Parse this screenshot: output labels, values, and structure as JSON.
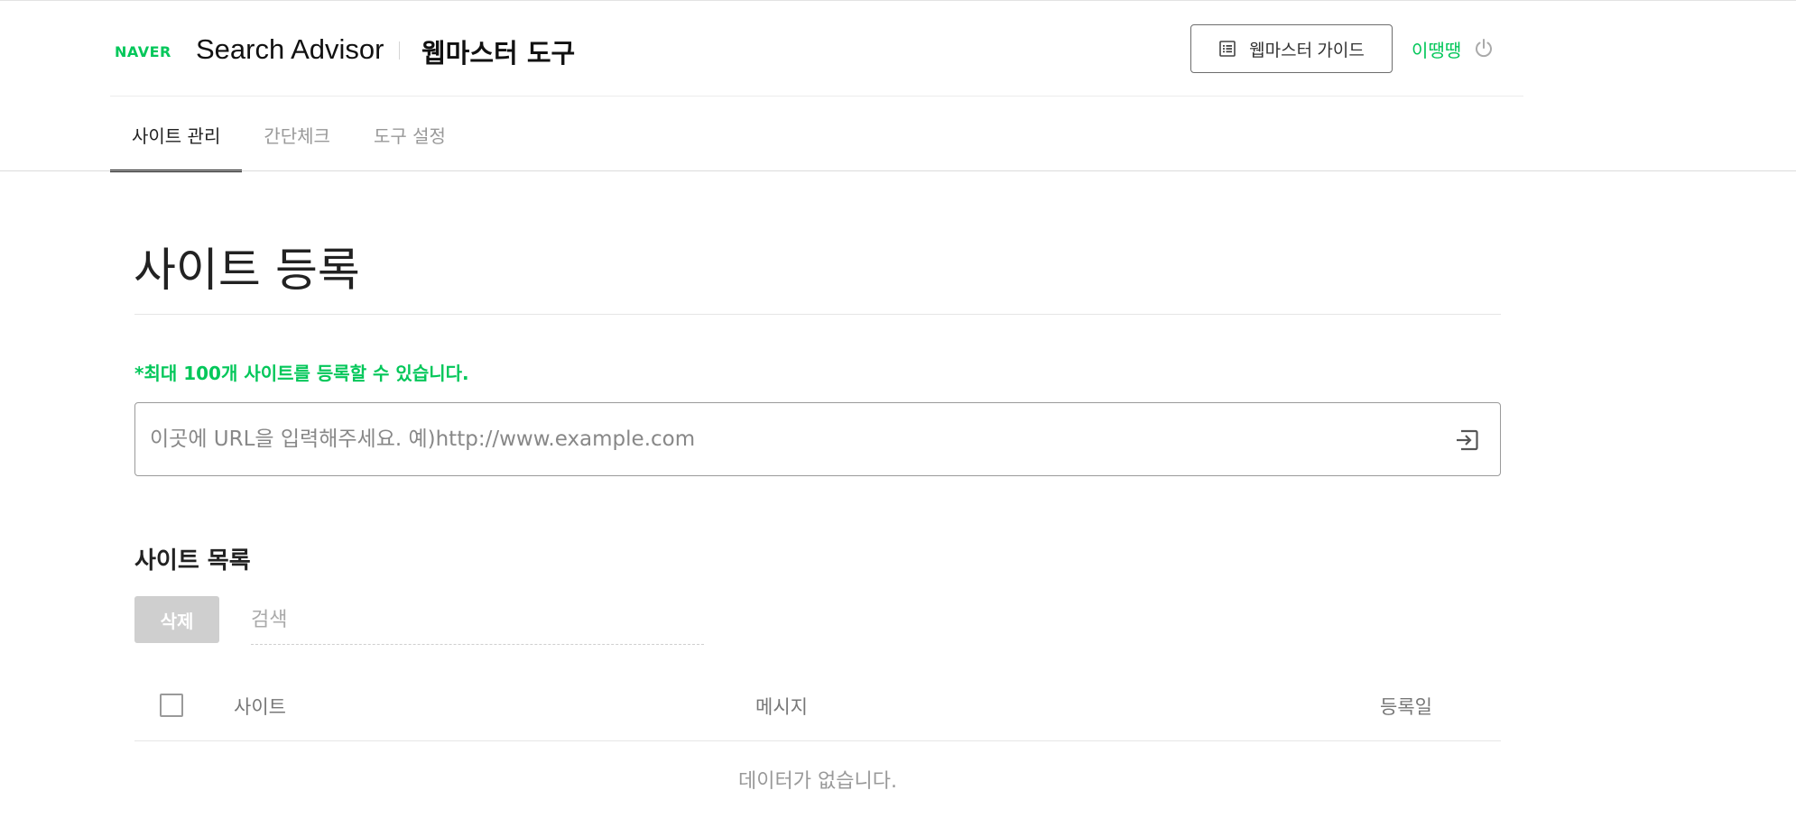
{
  "header": {
    "logo_text": "NAVER",
    "product_name": "Search Advisor",
    "tool_name": "웹마스터 도구",
    "guide_button_label": "웹마스터 가이드",
    "guide_icon": "document-list-icon",
    "user_name": "이땡땡",
    "power_icon": "power-icon"
  },
  "tabs": [
    {
      "label": "사이트 관리",
      "active": true
    },
    {
      "label": "간단체크",
      "active": false
    },
    {
      "label": "도구 설정",
      "active": false
    }
  ],
  "main": {
    "page_title": "사이트 등록",
    "limit_notice": "*최대 100개 사이트를 등록할 수 있습니다.",
    "url_input": {
      "value": "",
      "placeholder": "이곳에 URL을 입력해주세요. 예)http://www.example.com",
      "submit_icon": "enter-arrow-icon"
    },
    "list_title": "사이트 목록",
    "delete_button_label": "삭제",
    "search_placeholder": "검색",
    "table": {
      "columns": [
        "사이트",
        "메시지",
        "등록일"
      ],
      "rows": [],
      "empty_text": "데이터가 없습니다."
    }
  },
  "colors": {
    "brand_green": "#03c75a",
    "disabled_button": "#cfcfcf",
    "border_gray": "#9a9a9a"
  }
}
